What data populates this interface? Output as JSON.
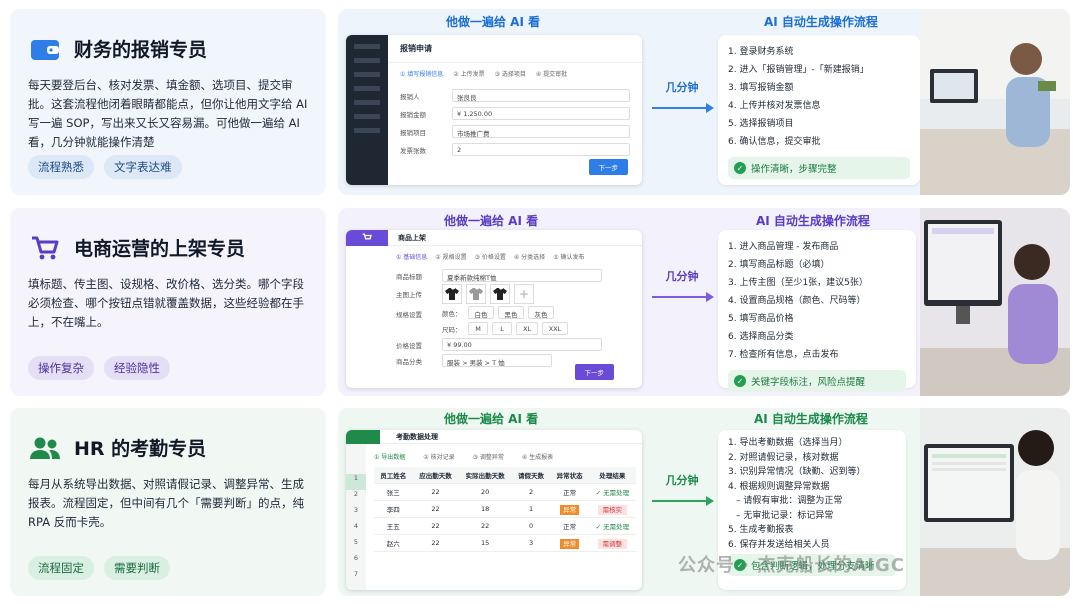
{
  "rows": [
    {
      "title": "财务的报销专员",
      "desc": "每天要登后台、核对发票、填金额、选项目、提交审批。这套流程他闭着眼睛都能点，但你让他用文字给 AI 写一遍 SOP，写出来又长又容易漏。可他做一遍给 AI 看，几分钟就能操作清楚",
      "tags": [
        "流程熟悉",
        "文字表达难"
      ],
      "head_left": "他做一遍给 AI 看",
      "head_right": "AI 自动生成操作流程",
      "arrow": "几分钟",
      "steps": [
        "1.  登录财务系统",
        "2.  进入「报销管理」-「新建报销」",
        "3.  填写报销金额",
        "4.  上传并核对发票信息",
        "5.  选择报销项目",
        "6.  确认信息，提交审批"
      ],
      "result": "操作清晰，步骤完整",
      "win": {
        "title": "报销申请",
        "steps": [
          "① 填写报销信息",
          "② 上传发票",
          "③ 选择项目",
          "④ 提交审批"
        ],
        "fields": [
          {
            "label": "报销人",
            "value": "张良良"
          },
          {
            "label": "报销金额",
            "value": "¥ 1,250.00"
          },
          {
            "label": "报销项目",
            "value": "市场推广费"
          },
          {
            "label": "发票张数",
            "value": "2"
          }
        ],
        "button": "下一步",
        "sidebar": [
          "报销管理",
          "我的报销",
          "审批中心",
          "预算管理",
          "发票管理",
          "报表统计"
        ]
      }
    },
    {
      "title": "电商运营的上架专员",
      "desc": "填标题、传主图、设规格、改价格、选分类。哪个字段必须检查、哪个按钮点错就覆盖数据，这些经验都在手上，不在嘴上。",
      "tags": [
        "操作复杂",
        "经验隐性"
      ],
      "head_left": "他做一遍给 AI 看",
      "head_right": "AI 自动生成操作流程",
      "arrow": "几分钟",
      "steps": [
        "1.  进入商品管理 - 发布商品",
        "2.  填写商品标题（必填）",
        "3.  上传主图（至少1张，建议5张）",
        "4.  设置商品规格（颜色、尺码等）",
        "5.  填写商品价格",
        "6.  选择商品分类",
        "7.  检查所有信息，点击发布"
      ],
      "result": "关键字段标注，风险点提醒",
      "win": {
        "title": "商品上架",
        "steps": [
          "① 基础信息",
          "② 规格设置",
          "③ 价格设置",
          "④ 分类选择",
          "⑤ 确认发布"
        ],
        "name_label": "商品标题",
        "name_value": "夏季新款纯棉T恤",
        "img_label": "主图上传",
        "spec_label": "规格设置",
        "color_label": "颜色：",
        "colors": [
          "白色",
          "黑色",
          "灰色"
        ],
        "size_label": "尺码：",
        "sizes": [
          "M",
          "L",
          "XL",
          "XXL"
        ],
        "price_label": "价格设置",
        "price_value": "¥ 99.00",
        "cat_label": "商品分类",
        "cat_value": "服装 > 男装 > T 恤",
        "button": "下一步"
      }
    },
    {
      "title": "HR 的考勤专员",
      "desc": "每月从系统导出数据、对照请假记录、调整异常、生成报表。流程固定，但中间有几个「需要判断」的点，纯 RPA 反而卡壳。",
      "tags": [
        "流程固定",
        "需要判断"
      ],
      "head_left": "他做一遍给 AI 看",
      "head_right": "AI 自动生成操作流程",
      "arrow": "几分钟",
      "steps": [
        "1.  导出考勤数据（选择当月）",
        "2.  对照请假记录，核对数据",
        "3.  识别异常情况（缺勤、迟到等）",
        "4.  根据规则调整异常数据",
        "     – 请假有审批：调整为正常",
        "     – 无审批记录：标记异常",
        "5.  生成考勤报表",
        "6.  保存并发送给相关人员"
      ],
      "result": "包含判断逻辑，处理分支清晰",
      "win": {
        "title": "考勤数据处理",
        "steps": [
          "① 导出数据",
          "② 核对记录",
          "③ 调整异常",
          "④ 生成报表"
        ],
        "headers": [
          "员工姓名",
          "应出勤天数",
          "实际出勤天数",
          "请假天数",
          "异常状态",
          "处理结果"
        ],
        "rows": [
          [
            "张三",
            "22",
            "20",
            "2",
            "正常",
            "✓ 无需处理"
          ],
          [
            "李四",
            "22",
            "18",
            "1",
            "异常",
            "需核实"
          ],
          [
            "王五",
            "22",
            "22",
            "0",
            "正常",
            "✓ 无需处理"
          ],
          [
            "赵六",
            "22",
            "15",
            "3",
            "异常",
            "需调整"
          ]
        ],
        "rownums": [
          "1",
          "2",
          "3",
          "4",
          "5",
          "6",
          "7"
        ]
      }
    }
  ],
  "watermark": "公众号 · 杰克船长的AIGC"
}
